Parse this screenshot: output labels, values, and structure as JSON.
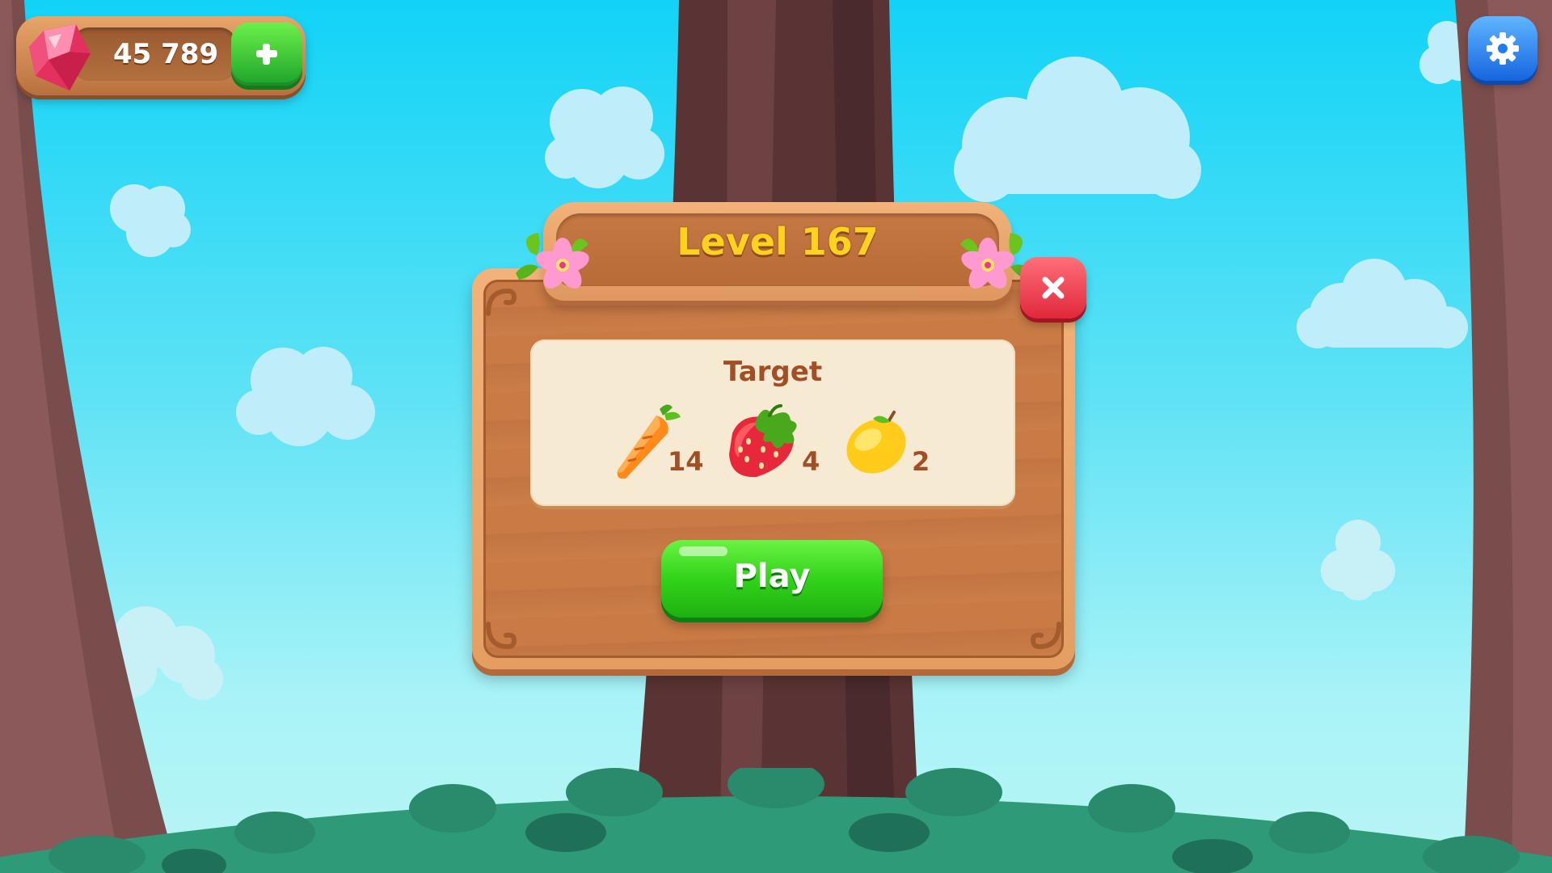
{
  "hud": {
    "gem_count": "45 789",
    "gem_icon": "pink-gem-icon",
    "add_icon": "plus-icon",
    "settings_icon": "gear-icon"
  },
  "dialog": {
    "title": "Level 167",
    "close_icon": "close-icon",
    "target_label": "Target",
    "targets": [
      {
        "icon": "carrot-icon",
        "count": "14"
      },
      {
        "icon": "strawberry-icon",
        "count": "4"
      },
      {
        "icon": "lemon-icon",
        "count": "2"
      }
    ],
    "play_label": "Play"
  },
  "colors": {
    "sky": "#11d3f7",
    "wood": "#c97a45",
    "title_yellow": "#ffd21f",
    "play_green": "#32d31a",
    "close_red": "#e0283a",
    "settings_blue": "#1e7bf0"
  }
}
